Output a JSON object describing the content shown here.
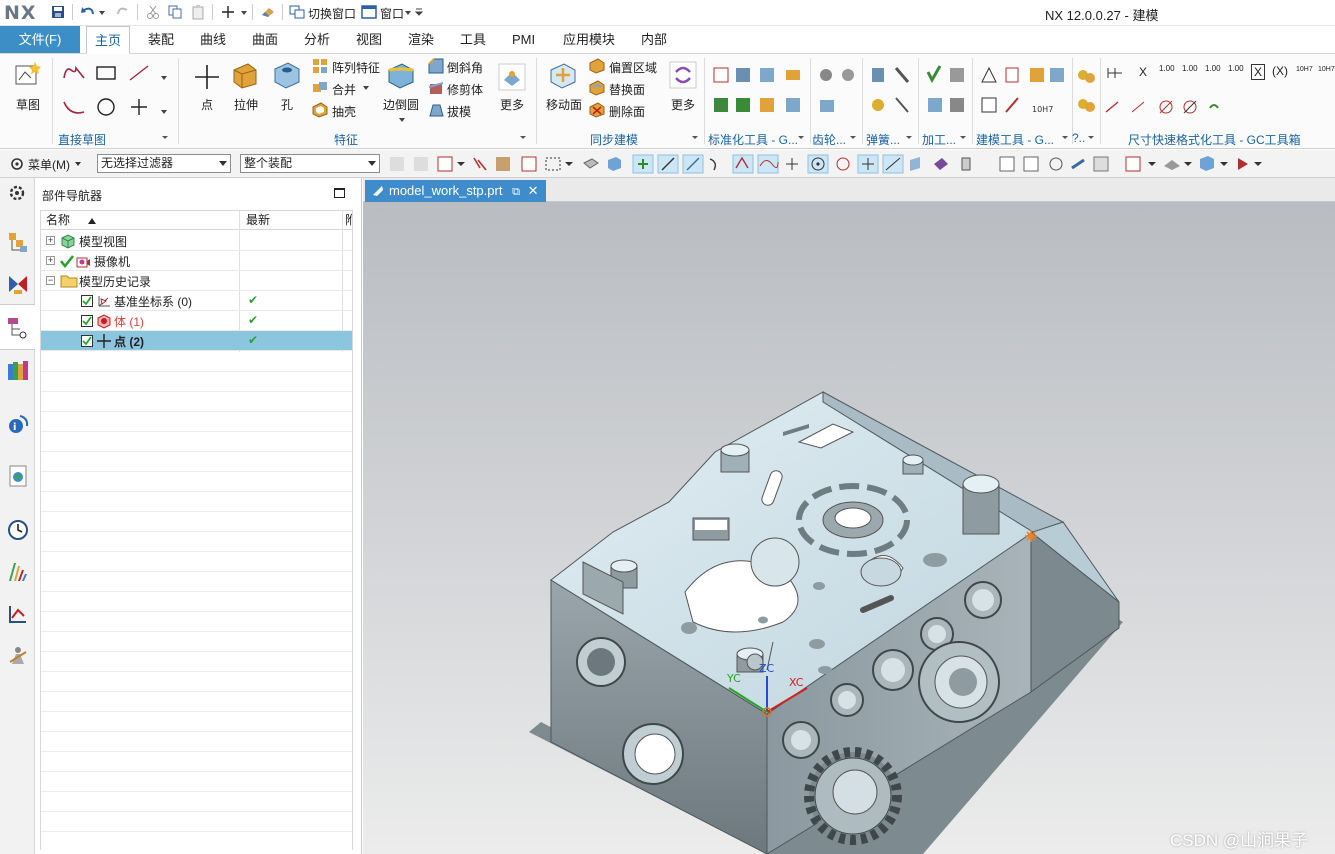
{
  "app": {
    "logo": "NX",
    "title": "NX 12.0.0.27 - 建模"
  },
  "quick_access": {
    "switch_window": "切换窗口",
    "window": "窗口"
  },
  "tabs": {
    "file": "文件(F)",
    "items": [
      "主页",
      "装配",
      "曲线",
      "曲面",
      "分析",
      "视图",
      "渲染",
      "工具",
      "PMI",
      "应用模块",
      "内部"
    ],
    "active": "主页"
  },
  "ribbon": {
    "direct_sketch": {
      "sketch_label": "草图",
      "group_label": "直接草图"
    },
    "feature": {
      "point": "点",
      "extrude": "拉伸",
      "hole": "孔",
      "pattern_feature": "阵列特征",
      "unite": "合并",
      "shell": "抽壳",
      "edge_blend": "边倒圆",
      "chamfer": "倒斜角",
      "trim_body": "修剪体",
      "draft": "拔模",
      "more": "更多",
      "group_label": "特征"
    },
    "sync": {
      "move_face": "移动面",
      "offset_region": "偏置区域",
      "replace_face": "替换面",
      "delete_face": "删除面",
      "more": "更多",
      "group_label": "同步建模"
    },
    "other_groups": {
      "standard_tools": "标准化工具 - G...",
      "gear": "齿轮...",
      "spring": "弹簧...",
      "machining": "加工...",
      "modeling_tools": "建模工具 - G...",
      "question": "?..",
      "dim_format": "尺寸快速格式化工具 - GC工具箱"
    },
    "dim_tools": [
      "X",
      "1.00",
      "1.00",
      "1.00",
      "1.00",
      "X",
      "(X)",
      "10H7",
      "10H7"
    ]
  },
  "filterbar": {
    "menu": "菜单(M)",
    "filter": "无选择过滤器",
    "scope": "整个装配"
  },
  "navigator": {
    "title": "部件导航器",
    "col_name": "名称",
    "col_latest": "最新",
    "col_third": "附",
    "rows": [
      {
        "label": "模型视图",
        "latest": ""
      },
      {
        "label": "摄像机",
        "latest": ""
      },
      {
        "label": "模型历史记录",
        "latest": ""
      },
      {
        "label": "基准坐标系 (0)",
        "latest": "✔"
      },
      {
        "label": "体 (1)",
        "latest": "✔"
      },
      {
        "label": "点 (2)",
        "latest": "✔"
      }
    ]
  },
  "graphics": {
    "doc_tab": "model_work_stp.prt",
    "axis_x": "XC",
    "axis_y": "YC",
    "axis_z": "ZC",
    "watermark": "CSDN @山涧果子"
  },
  "colors": {
    "accent": "#3c8fc6",
    "selection": "#8cc6de",
    "check_green": "#2aa32a",
    "body_red": "#d9403a",
    "part_face": "#c9dde6",
    "part_side": "#8a979e"
  }
}
